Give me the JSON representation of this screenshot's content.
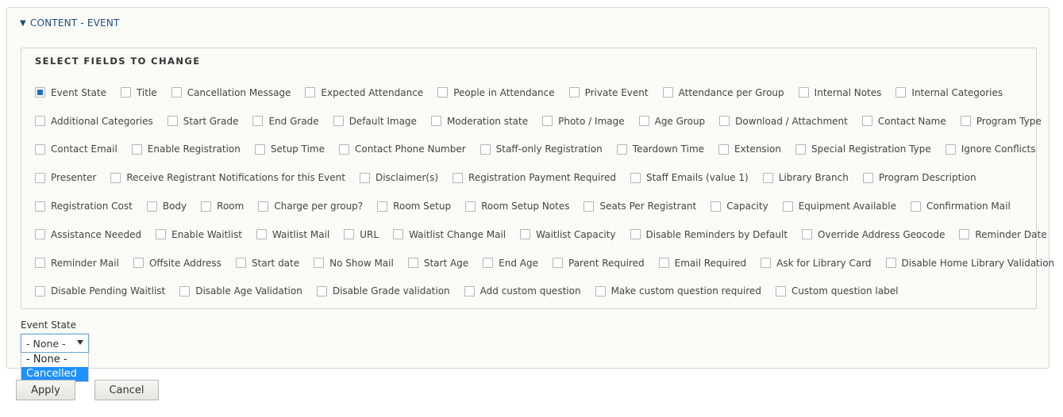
{
  "section": {
    "title": "CONTENT - EVENT",
    "expanded": true
  },
  "fields": {
    "legend": "SELECT FIELDS TO CHANGE",
    "rows": [
      [
        {
          "label": "Event State",
          "checked": true
        },
        {
          "label": "Title",
          "checked": false
        },
        {
          "label": "Cancellation Message",
          "checked": false
        },
        {
          "label": "Expected Attendance",
          "checked": false
        },
        {
          "label": "People in Attendance",
          "checked": false
        },
        {
          "label": "Private Event",
          "checked": false
        },
        {
          "label": "Attendance per Group",
          "checked": false
        },
        {
          "label": "Internal Notes",
          "checked": false
        },
        {
          "label": "Internal Categories",
          "checked": false
        }
      ],
      [
        {
          "label": "Additional Categories",
          "checked": false
        },
        {
          "label": "Start Grade",
          "checked": false
        },
        {
          "label": "End Grade",
          "checked": false
        },
        {
          "label": "Default Image",
          "checked": false
        },
        {
          "label": "Moderation state",
          "checked": false
        },
        {
          "label": "Photo / Image",
          "checked": false
        },
        {
          "label": "Age Group",
          "checked": false
        },
        {
          "label": "Download / Attachment",
          "checked": false
        },
        {
          "label": "Contact Name",
          "checked": false
        },
        {
          "label": "Program Type",
          "checked": false
        }
      ],
      [
        {
          "label": "Contact Email",
          "checked": false
        },
        {
          "label": "Enable Registration",
          "checked": false
        },
        {
          "label": "Setup Time",
          "checked": false
        },
        {
          "label": "Contact Phone Number",
          "checked": false
        },
        {
          "label": "Staff-only Registration",
          "checked": false
        },
        {
          "label": "Teardown Time",
          "checked": false
        },
        {
          "label": "Extension",
          "checked": false
        },
        {
          "label": "Special Registration Type",
          "checked": false
        },
        {
          "label": "Ignore Conflicts",
          "checked": false
        }
      ],
      [
        {
          "label": "Presenter",
          "checked": false
        },
        {
          "label": "Receive Registrant Notifications for this Event",
          "checked": false
        },
        {
          "label": "Disclaimer(s)",
          "checked": false
        },
        {
          "label": "Registration Payment Required",
          "checked": false
        },
        {
          "label": "Staff Emails (value 1)",
          "checked": false
        },
        {
          "label": "Library Branch",
          "checked": false
        },
        {
          "label": "Program Description",
          "checked": false
        }
      ],
      [
        {
          "label": "Registration Cost",
          "checked": false
        },
        {
          "label": "Body",
          "checked": false
        },
        {
          "label": "Room",
          "checked": false
        },
        {
          "label": "Charge per group?",
          "checked": false
        },
        {
          "label": "Room Setup",
          "checked": false
        },
        {
          "label": "Room Setup Notes",
          "checked": false
        },
        {
          "label": "Seats Per Registrant",
          "checked": false
        },
        {
          "label": "Capacity",
          "checked": false
        },
        {
          "label": "Equipment Available",
          "checked": false
        },
        {
          "label": "Confirmation Mail",
          "checked": false
        }
      ],
      [
        {
          "label": "Assistance Needed",
          "checked": false
        },
        {
          "label": "Enable Waitlist",
          "checked": false
        },
        {
          "label": "Waitlist Mail",
          "checked": false
        },
        {
          "label": "URL",
          "checked": false
        },
        {
          "label": "Waitlist Change Mail",
          "checked": false
        },
        {
          "label": "Waitlist Capacity",
          "checked": false
        },
        {
          "label": "Disable Reminders by Default",
          "checked": false
        },
        {
          "label": "Override Address Geocode",
          "checked": false
        },
        {
          "label": "Reminder Date",
          "checked": false
        }
      ],
      [
        {
          "label": "Reminder Mail",
          "checked": false
        },
        {
          "label": "Offsite Address",
          "checked": false
        },
        {
          "label": "Start date",
          "checked": false
        },
        {
          "label": "No Show Mail",
          "checked": false
        },
        {
          "label": "Start Age",
          "checked": false
        },
        {
          "label": "End Age",
          "checked": false
        },
        {
          "label": "Parent Required",
          "checked": false
        },
        {
          "label": "Email Required",
          "checked": false
        },
        {
          "label": "Ask for Library Card",
          "checked": false
        },
        {
          "label": "Disable Home Library Validation",
          "checked": false
        }
      ],
      [
        {
          "label": "Disable Pending Waitlist",
          "checked": false
        },
        {
          "label": "Disable Age Validation",
          "checked": false
        },
        {
          "label": "Disable Grade validation",
          "checked": false
        },
        {
          "label": "Add custom question",
          "checked": false
        },
        {
          "label": "Make custom question required",
          "checked": false
        },
        {
          "label": "Custom question label",
          "checked": false
        }
      ]
    ]
  },
  "event_state": {
    "label": "Event State",
    "value": "- None -",
    "options": [
      "- None -",
      "Cancelled"
    ],
    "highlighted_option": "Cancelled"
  },
  "actions": {
    "apply_label": "Apply",
    "cancel_label": "Cancel"
  },
  "colors": {
    "accent": "#1f6fbf",
    "section_title": "#1f4d7a",
    "dropdown_highlight": "#1e90ff"
  }
}
